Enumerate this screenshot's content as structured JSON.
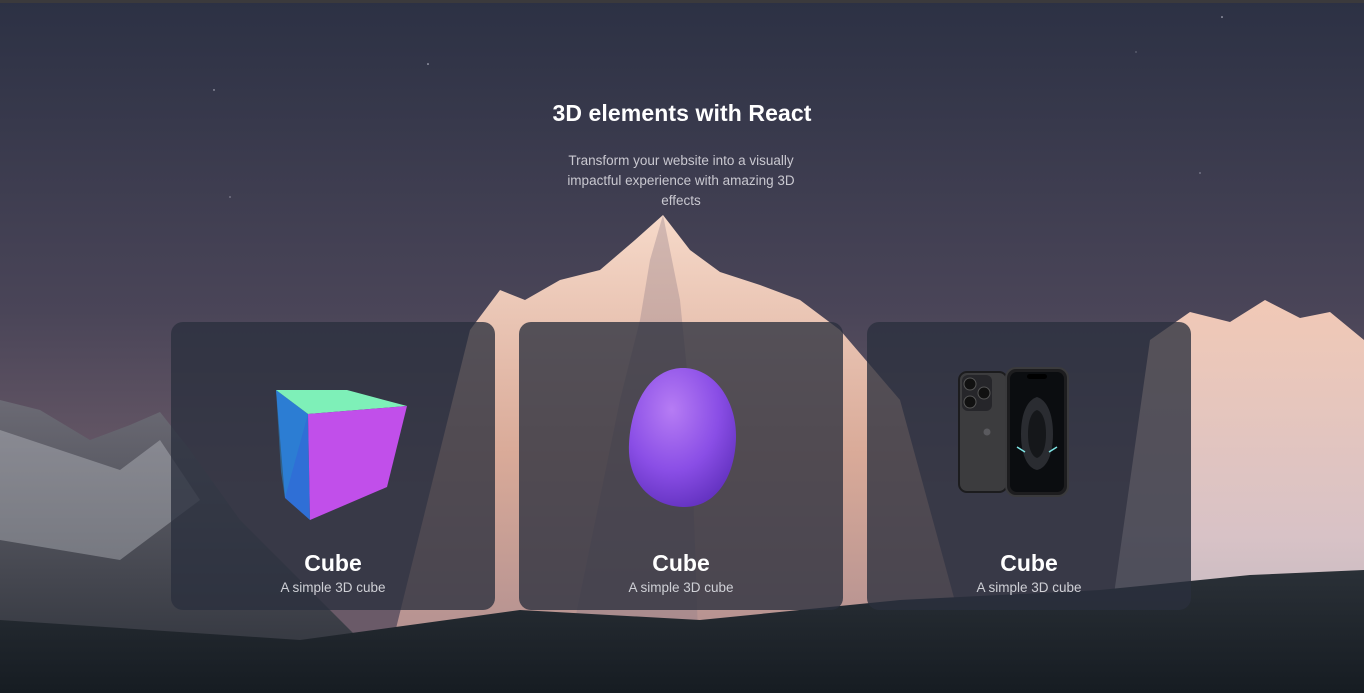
{
  "hero": {
    "title": "3D elements with React",
    "subtitle": "Transform your website into a visually impactful experience with amazing 3D effects"
  },
  "cards": [
    {
      "title": "Cube",
      "description": "A simple 3D cube",
      "visual_icon": "cube-3d-icon"
    },
    {
      "title": "Cube",
      "description": "A simple 3D cube",
      "visual_icon": "blob-3d-icon"
    },
    {
      "title": "Cube",
      "description": "A simple 3D cube",
      "visual_icon": "phone-3d-icon"
    }
  ],
  "colors": {
    "sky_top": "#2c3144",
    "sky_bottom": "#5b5466",
    "card_bg": "#2a2f3e",
    "cube_front": "#c14fea",
    "cube_top": "#7ef0b8",
    "cube_side": "#2f6fd6",
    "blob": "#8a4ee6"
  }
}
